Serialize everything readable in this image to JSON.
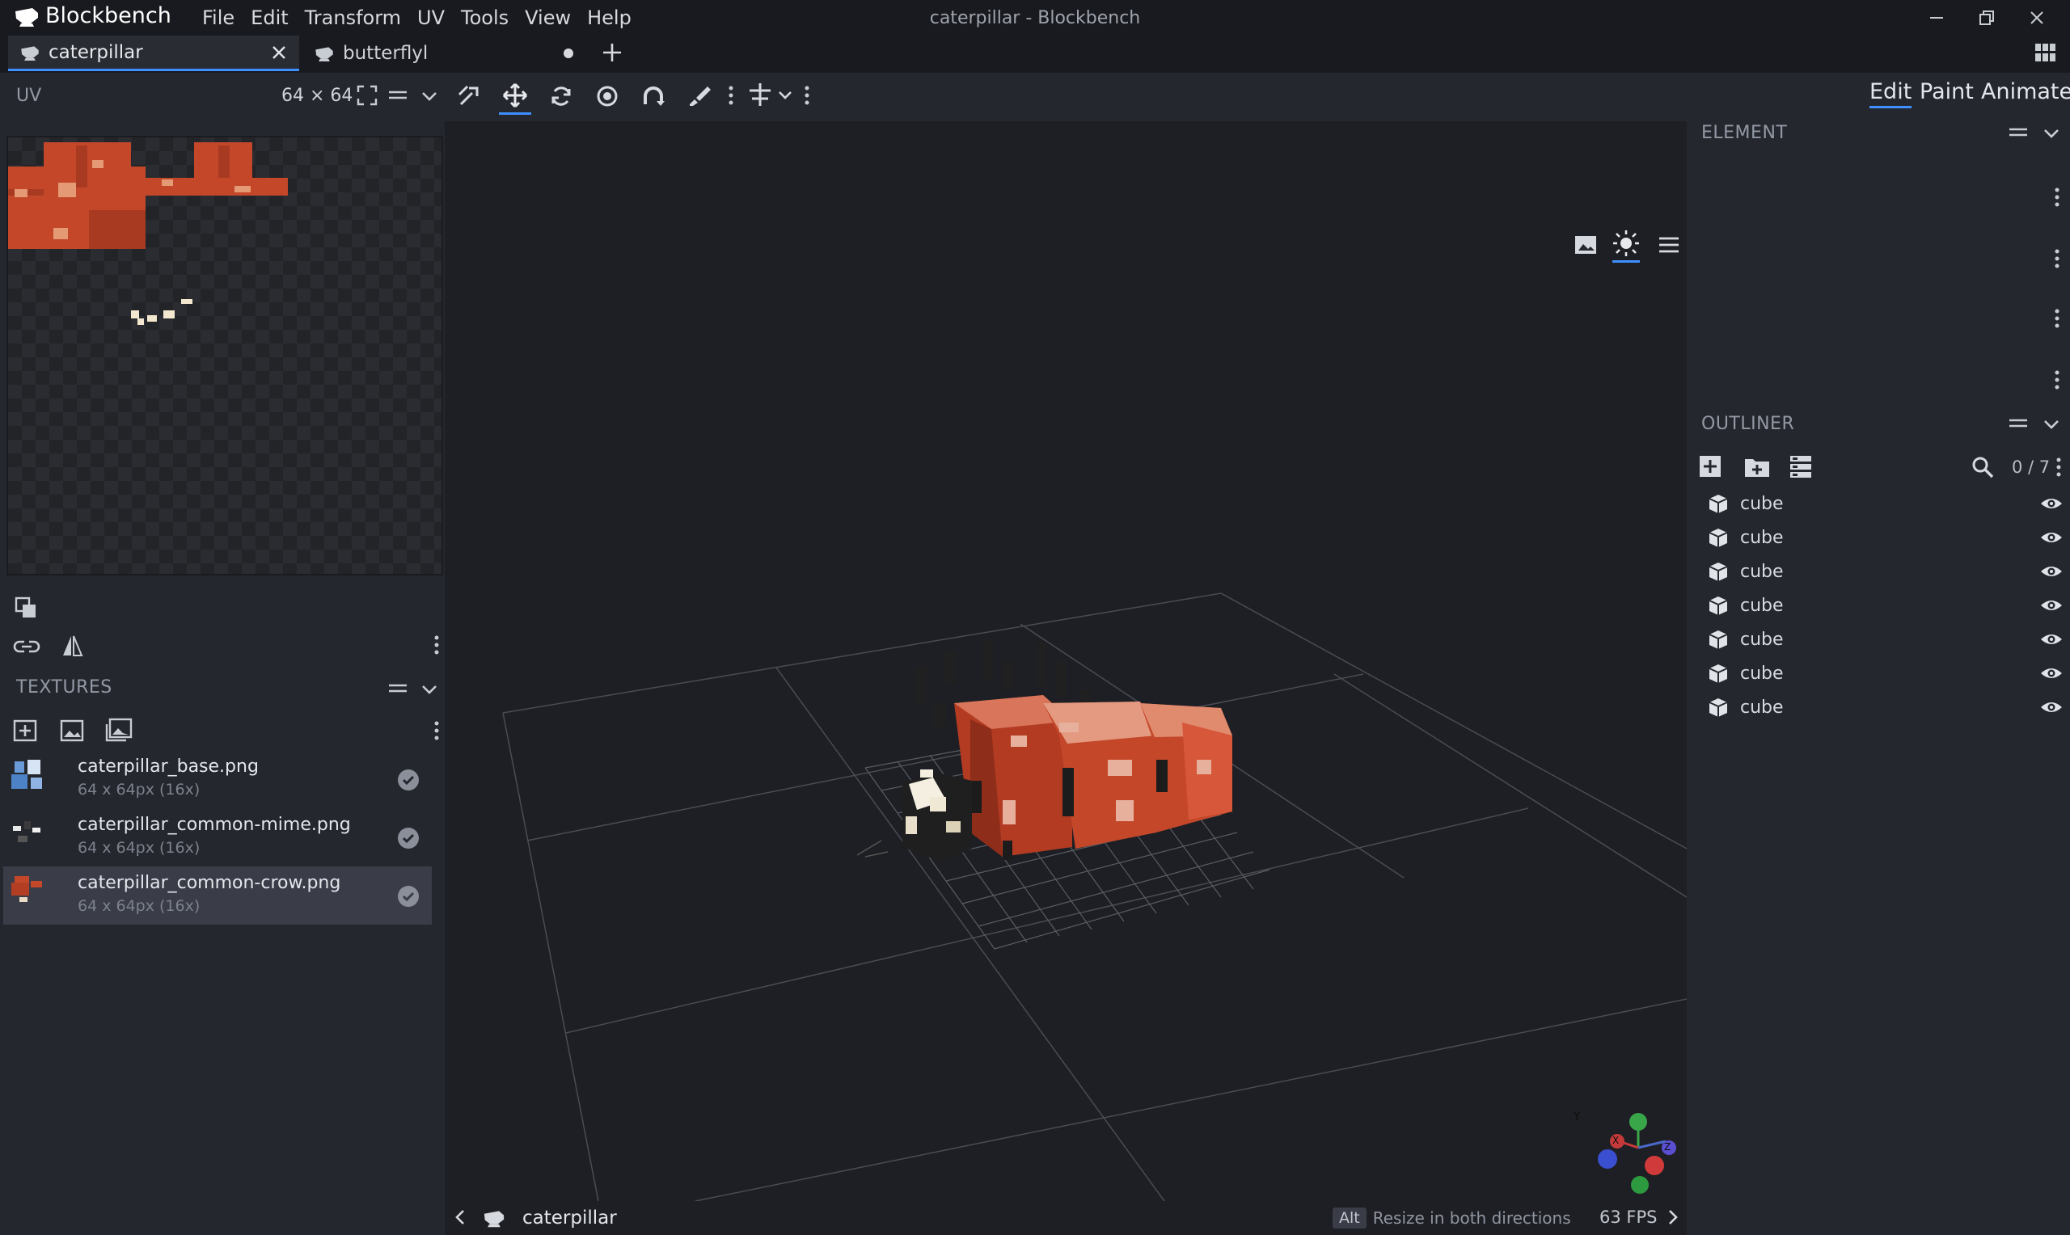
{
  "app": {
    "name": "Blockbench",
    "window_title": "caterpillar - Blockbench"
  },
  "menu": [
    "File",
    "Edit",
    "Transform",
    "UV",
    "Tools",
    "View",
    "Help"
  ],
  "tabs": [
    {
      "label": "caterpillar",
      "active": true
    },
    {
      "label": "butterflyl",
      "active": false
    }
  ],
  "uv_panel": {
    "title": "UV",
    "size": "64 × 64"
  },
  "modes": [
    "Edit",
    "Paint",
    "Animate"
  ],
  "textures": {
    "title": "TEXTURES",
    "items": [
      {
        "name": "caterpillar_base.png",
        "meta": "64 x 64px (16x)",
        "selected": false
      },
      {
        "name": "caterpillar_common-mime.png",
        "meta": "64 x 64px (16x)",
        "selected": false
      },
      {
        "name": "caterpillar_common-crow.png",
        "meta": "64 x 64px (16x)",
        "selected": true
      }
    ]
  },
  "element_panel": {
    "title": "ELEMENT"
  },
  "outliner": {
    "title": "OUTLINER",
    "count": "0 / 7",
    "items": [
      "cube",
      "cube",
      "cube",
      "cube",
      "cube",
      "cube",
      "cube"
    ]
  },
  "statusbar": {
    "project": "caterpillar",
    "key": "Alt",
    "hint": "Resize in both directions",
    "fps": "63 FPS"
  },
  "gizmo": {
    "x": "X",
    "y": "Y",
    "z": "Z"
  },
  "colors": {
    "accent": "#3e90ff",
    "texture_orange": "#c4472a",
    "background": "#1e1f24",
    "panel": "#25272e"
  }
}
